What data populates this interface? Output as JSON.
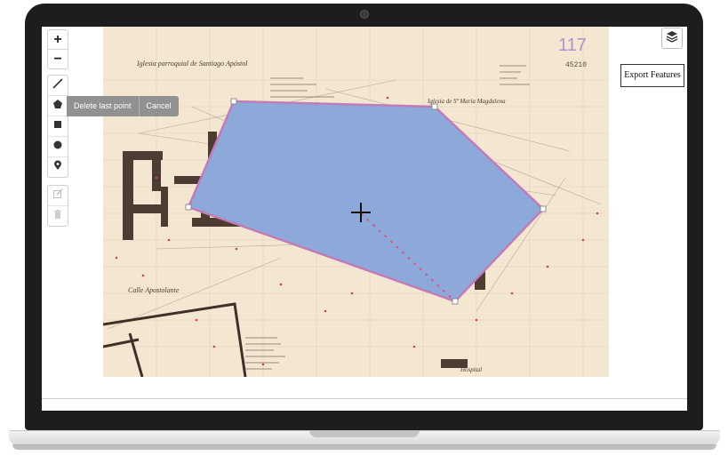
{
  "zoom": {
    "in_label": "+",
    "out_label": "−"
  },
  "draw_toolbar": {
    "tools": [
      "polyline-icon",
      "polygon-icon",
      "rectangle-icon",
      "circle-icon",
      "marker-icon"
    ],
    "actions": {
      "delete_last_point": "Delete last point",
      "cancel": "Cancel"
    }
  },
  "edit_toolbar": {
    "tools": [
      "edit-layers-icon",
      "delete-layers-icon"
    ]
  },
  "layers": {
    "icon": "layers-icon"
  },
  "export": {
    "label": "Export Features"
  },
  "map": {
    "stamp_number": "117",
    "catalog_number": "45210",
    "title_top_left": "Iglesia parroquial de Santiago Apóstol",
    "title_right": "Iglesia de Sª María Magdalena",
    "label_bottom_left": "Calle Apostolante",
    "label_bottom_right": "Hospital"
  },
  "colors": {
    "polygon_fill": "#8da9d9",
    "polygon_stroke": "#c27bb8",
    "paper": "#f3e7d2",
    "toolbar_actions": "#919191"
  }
}
